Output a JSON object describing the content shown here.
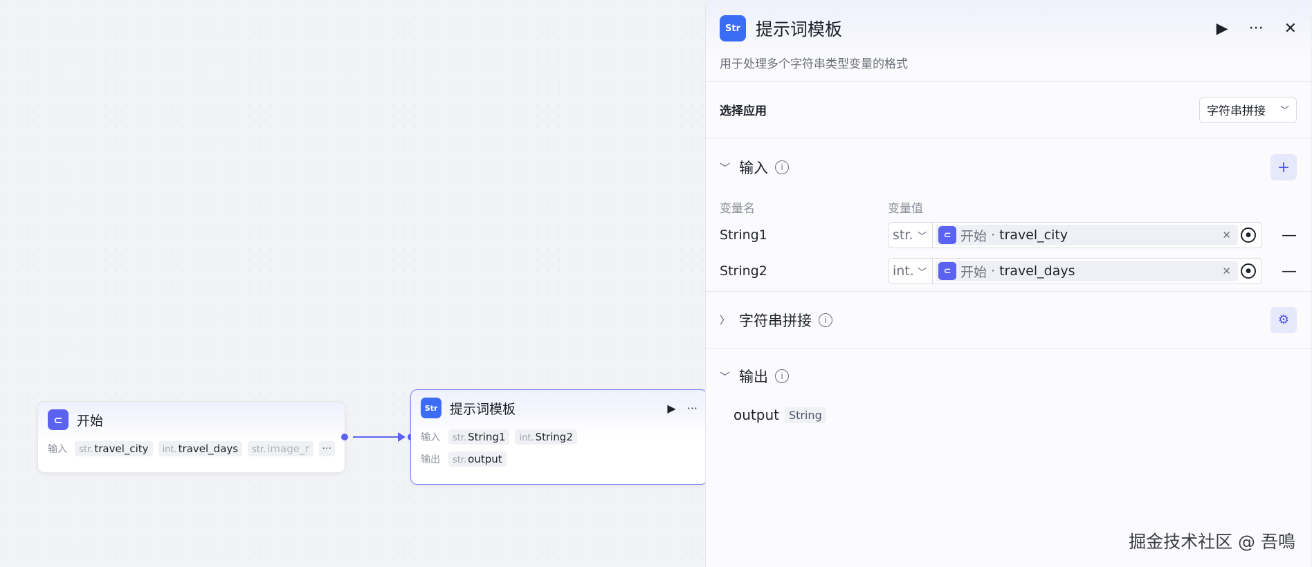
{
  "canvas": {
    "start_node": {
      "title": "开始",
      "input_label": "输入",
      "params": [
        {
          "type": "str.",
          "name": "travel_city"
        },
        {
          "type": "int.",
          "name": "travel_days"
        },
        {
          "type": "str.",
          "name": "image_r"
        }
      ],
      "more": "···"
    },
    "template_node": {
      "icon_text": "Str",
      "title": "提示词模板",
      "input_label": "输入",
      "output_label": "输出",
      "inputs": [
        {
          "type": "str.",
          "name": "String1"
        },
        {
          "type": "int.",
          "name": "String2"
        }
      ],
      "outputs": [
        {
          "type": "str.",
          "name": "output"
        }
      ]
    }
  },
  "panel": {
    "icon_text": "Str",
    "title": "提示词模板",
    "description": "用于处理多个字符串类型变量的格式",
    "app_select": {
      "label": "选择应用",
      "value": "字符串拼接"
    },
    "input_section": {
      "title": "输入",
      "col_name": "变量名",
      "col_value": "变量值",
      "rows": [
        {
          "name": "String1",
          "type": "str.",
          "source": "开始",
          "sep": "·",
          "var": "travel_city"
        },
        {
          "name": "String2",
          "type": "int.",
          "source": "开始",
          "sep": "·",
          "var": "travel_days"
        }
      ]
    },
    "concat_section": {
      "title": "字符串拼接"
    },
    "output_section": {
      "title": "输出",
      "outputs": [
        {
          "name": "output",
          "type": "String"
        }
      ]
    }
  },
  "watermark": "掘金技术社区 @ 吾鳴"
}
